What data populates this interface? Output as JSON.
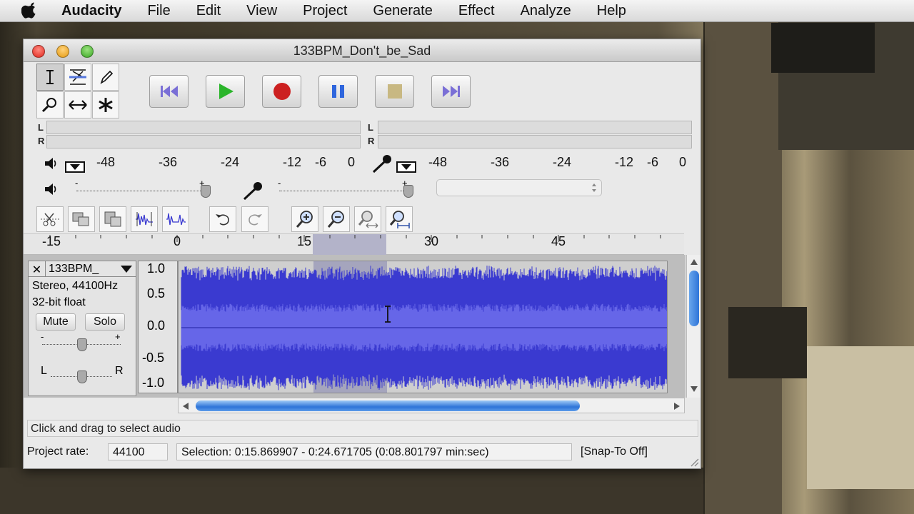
{
  "menubar": {
    "app_name": "Audacity",
    "items": [
      "File",
      "Edit",
      "View",
      "Project",
      "Generate",
      "Effect",
      "Analyze",
      "Help"
    ]
  },
  "window": {
    "title": "133BPM_Don't_be_Sad"
  },
  "meters": {
    "left_label": "L",
    "right_label": "R",
    "play_scale": [
      "-48",
      "-36",
      "-24",
      "-12",
      "-6",
      "0"
    ],
    "rec_scale": [
      "-48",
      "-36",
      "-24",
      "-12",
      "-6",
      "0"
    ]
  },
  "mixer": {
    "minus": "-",
    "plus": "+"
  },
  "timeline": {
    "ticks": [
      "-15",
      "0",
      "15",
      "30",
      "45"
    ]
  },
  "track": {
    "name": "133BPM_",
    "info_line1": "Stereo, 44100Hz",
    "info_line2": "32-bit float",
    "mute_label": "Mute",
    "solo_label": "Solo",
    "gain_minus": "-",
    "gain_plus": "+",
    "pan_left": "L",
    "pan_right": "R",
    "y_axis": [
      "1.0",
      "0.5",
      "0.0",
      "-0.5",
      "-1.0"
    ],
    "close_glyph": "✕"
  },
  "status": {
    "hint": "Click and drag to select audio",
    "project_rate_label": "Project rate:",
    "project_rate_value": "44100",
    "selection_text": "Selection: 0:15.869907 - 0:24.671705 (0:08.801797 min:sec)",
    "snap_text": "[Snap-To Off]"
  },
  "colors": {
    "waveform": "#3a3ad0",
    "waveform_rms": "#6666e8",
    "selection": "#9a9ab5",
    "record": "#cc2020",
    "play": "#2bb52b",
    "pause": "#2f66dd"
  },
  "icons": {
    "transport": [
      "skip-to-start-icon",
      "play-icon",
      "record-icon",
      "pause-icon",
      "stop-icon",
      "skip-to-end-icon"
    ],
    "tools": [
      "selection-tool-icon",
      "envelope-tool-icon",
      "draw-tool-icon",
      "zoom-tool-icon",
      "timeshift-tool-icon",
      "multi-tool-icon"
    ],
    "edit": [
      "cut-icon",
      "copy-icon",
      "paste-icon",
      "trim-icon",
      "silence-icon",
      "undo-icon",
      "redo-icon",
      "zoom-in-icon",
      "zoom-out-icon",
      "fit-selection-icon",
      "fit-project-icon"
    ]
  }
}
